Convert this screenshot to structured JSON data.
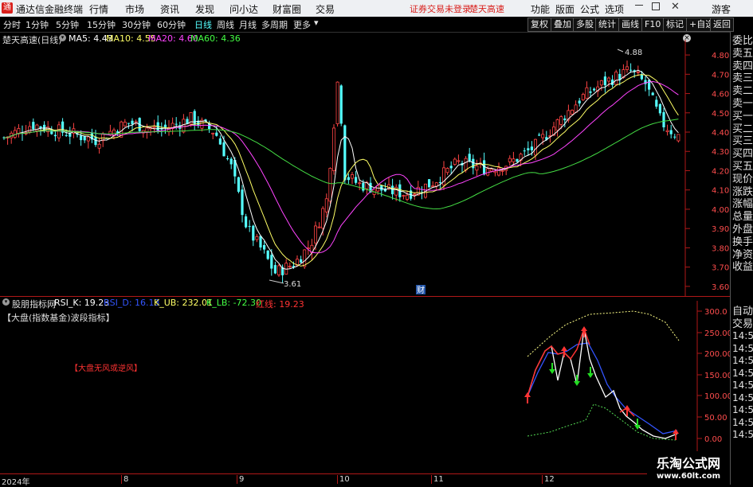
{
  "menubar": {
    "app_title": "通达信金融终端",
    "items": [
      "行情",
      "市场",
      "资讯",
      "发现",
      "问小达",
      "财富圈",
      "交易"
    ],
    "notice": "证券交易未登录",
    "stock_link": "楚天高速",
    "right_items": [
      "功能",
      "版面",
      "公式",
      "选项"
    ],
    "guest": "游客"
  },
  "toolbar": {
    "periods": [
      "分时",
      "1分钟",
      "5分钟",
      "15分钟",
      "30分钟",
      "60分钟",
      "日线",
      "周线",
      "月线",
      "多周期",
      "更多"
    ],
    "active_period": "日线",
    "right_buttons": [
      "复权",
      "叠加",
      "多股",
      "统计",
      "画线",
      "F10",
      "标记",
      "+自选",
      "返回"
    ]
  },
  "main_chart": {
    "title": "楚天高速(日线)",
    "ma_labels": [
      {
        "text": "MA5: 4.43",
        "color": "#ffffff"
      },
      {
        "text": "MA10: 4.55",
        "color": "#ffff66"
      },
      {
        "text": "MA20: 4.60",
        "color": "#ff44ff"
      },
      {
        "text": "MA60: 4.36",
        "color": "#44ff44"
      }
    ],
    "high_label": "4.88",
    "low_label": "3.61",
    "fin_badge": "财",
    "y_ticks": [
      "4.80",
      "4.70",
      "4.60",
      "4.50",
      "4.40",
      "4.30",
      "4.20",
      "4.10",
      "4.00",
      "3.90",
      "3.80",
      "3.70",
      "3.60"
    ],
    "ylim": [
      3.55,
      4.92
    ]
  },
  "sub_chart": {
    "indicator_name": "股朋指标网",
    "labels": [
      {
        "text": "RSI_K: 19.23",
        "color": "#ffffff"
      },
      {
        "text": "RSI_D: 16.13",
        "color": "#3355ff"
      },
      {
        "text": "K_UB: 232.01",
        "color": "#ffff66"
      },
      {
        "text": "K_LB: -72.30",
        "color": "#44ff44"
      },
      {
        "text": "红线: 19.23",
        "color": "#ff3333"
      }
    ],
    "subtitle": "【大盘(指数基金)波段指标】",
    "annotation": "【大盘无风或逆风】",
    "y_ticks": [
      "300.0",
      "250.00",
      "200.00",
      "150.00",
      "100.00",
      "50.00",
      "0.00"
    ]
  },
  "x_axis": [
    "2024年",
    "8",
    "9",
    "10",
    "11",
    "12"
  ],
  "right_panel": {
    "quote_items": [
      "委比",
      "卖五",
      "卖四",
      "卖三",
      "卖二",
      "卖一",
      "买一",
      "买二",
      "买三",
      "买四",
      "买五",
      "现价",
      "涨跌",
      "涨幅",
      "总量",
      "外盘",
      "换手",
      "净资",
      "收益"
    ],
    "sub_items": [
      "自动",
      "交易",
      "14:56",
      "14:56",
      "14:56",
      "14:56",
      "14:56",
      "14:56",
      "14:56",
      "14:56",
      "14:56"
    ]
  },
  "watermark": {
    "title": "乐淘公式网",
    "url": "www.60lt.com"
  }
}
